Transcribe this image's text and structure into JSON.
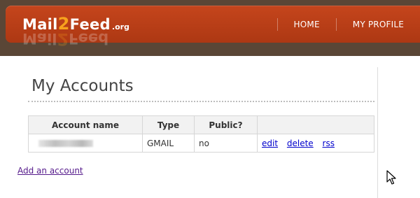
{
  "header": {
    "logo": {
      "part1": "Mail",
      "accent": "2",
      "part2": "Feed",
      "tld": ".org"
    },
    "nav": [
      {
        "label": "HOME"
      },
      {
        "label": "MY PROFILE"
      }
    ]
  },
  "main": {
    "title": "My Accounts",
    "table": {
      "columns": [
        "Account name",
        "Type",
        "Public?",
        ""
      ],
      "rows": [
        {
          "account_name": "",
          "type": "GMAIL",
          "public": "no",
          "actions": [
            "edit",
            "delete",
            "rss"
          ]
        }
      ]
    },
    "add_link": "Add an account"
  },
  "colors": {
    "header_bg": "#b93f17",
    "top_strip": "#5a4636",
    "logo_accent": "#f7a21d",
    "link": "#0000cc",
    "visited_link": "#551a8b"
  }
}
